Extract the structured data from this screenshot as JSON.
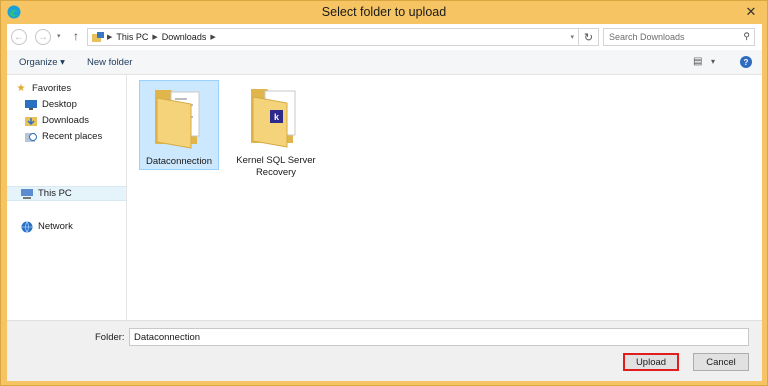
{
  "window": {
    "title": "Select folder to upload",
    "close_glyph": "✕"
  },
  "nav": {
    "back_glyph": "←",
    "forward_glyph": "→",
    "dropdown_glyph": "▾",
    "up_glyph": "↑",
    "breadcrumb": [
      "This PC",
      "Downloads"
    ],
    "breadcrumb_sep": "▶",
    "refresh_glyph": "↻",
    "search_placeholder": "Search Downloads",
    "search_glyph": "⚲"
  },
  "toolbar": {
    "organize_label": "Organize ▾",
    "new_folder_label": "New folder",
    "view_glyph": "▤",
    "view_dd_glyph": "▾",
    "help_glyph": "?"
  },
  "sidebar": {
    "favorites_label": "Favorites",
    "favorites": [
      {
        "label": "Desktop"
      },
      {
        "label": "Downloads"
      },
      {
        "label": "Recent places"
      }
    ],
    "this_pc_label": "This PC",
    "network_label": "Network"
  },
  "files": [
    {
      "label": "Dataconnection",
      "selected": true
    },
    {
      "label": "Kernel SQL Server Recovery",
      "selected": false,
      "badge": "k"
    }
  ],
  "footer": {
    "folder_label": "Folder:",
    "folder_value": "Dataconnection",
    "upload_label": "Upload",
    "cancel_label": "Cancel"
  },
  "colors": {
    "frame": "#f6c463",
    "selection": "#cce8ff",
    "highlight_border": "#e01e1e"
  }
}
